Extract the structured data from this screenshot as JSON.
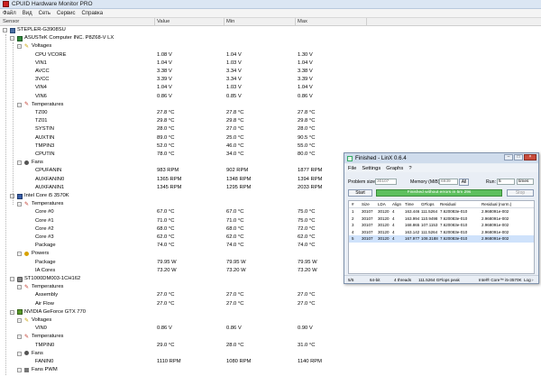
{
  "window": {
    "title": "CPUID Hardware Monitor PRO"
  },
  "menu": [
    "Файл",
    "Вид",
    "Сеть",
    "Сервис",
    "Справка"
  ],
  "columns": {
    "sensor": "Sensor",
    "value": "Value",
    "min": "Min",
    "max": "Max"
  },
  "tree": [
    {
      "indent": 0,
      "icon": "pc",
      "expander": true,
      "label": "STEPLER-G3908SU",
      "value": "",
      "min": "",
      "max": ""
    },
    {
      "indent": 1,
      "icon": "mb",
      "expander": true,
      "label": "ASUSTeK Computer INC. P8Z68-V LX",
      "value": "",
      "min": "",
      "max": ""
    },
    {
      "indent": 2,
      "icon": "volt",
      "expander": true,
      "label": "Voltages",
      "value": "",
      "min": "",
      "max": ""
    },
    {
      "indent": 3,
      "icon": "",
      "expander": false,
      "label": "CPU VCORE",
      "value": "1.08 V",
      "min": "1.04 V",
      "max": "1.30 V"
    },
    {
      "indent": 3,
      "icon": "",
      "expander": false,
      "label": "VIN1",
      "value": "1.04 V",
      "min": "1.03 V",
      "max": "1.04 V"
    },
    {
      "indent": 3,
      "icon": "",
      "expander": false,
      "label": "AVCC",
      "value": "3.38 V",
      "min": "3.34 V",
      "max": "3.38 V"
    },
    {
      "indent": 3,
      "icon": "",
      "expander": false,
      "label": "3VCC",
      "value": "3.39 V",
      "min": "3.34 V",
      "max": "3.39 V"
    },
    {
      "indent": 3,
      "icon": "",
      "expander": false,
      "label": "VIN4",
      "value": "1.04 V",
      "min": "1.03 V",
      "max": "1.04 V"
    },
    {
      "indent": 3,
      "icon": "",
      "expander": false,
      "label": "VIN6",
      "value": "0.86 V",
      "min": "0.85 V",
      "max": "0.86 V"
    },
    {
      "indent": 2,
      "icon": "temp",
      "expander": true,
      "label": "Temperatures",
      "value": "",
      "min": "",
      "max": ""
    },
    {
      "indent": 3,
      "icon": "",
      "expander": false,
      "label": "TZ00",
      "value": "27.8 °C",
      "min": "27.8 °C",
      "max": "27.8 °C"
    },
    {
      "indent": 3,
      "icon": "",
      "expander": false,
      "label": "TZ01",
      "value": "29.8 °C",
      "min": "29.8 °C",
      "max": "29.8 °C"
    },
    {
      "indent": 3,
      "icon": "",
      "expander": false,
      "label": "SYSTIN",
      "value": "28.0 °C",
      "min": "27.0 °C",
      "max": "28.0 °C"
    },
    {
      "indent": 3,
      "icon": "",
      "expander": false,
      "label": "AUXTIN",
      "value": "89.0 °C",
      "min": "25.0 °C",
      "max": "90.5 °C"
    },
    {
      "indent": 3,
      "icon": "",
      "expander": false,
      "label": "TMPIN3",
      "value": "52.0 °C",
      "min": "46.0 °C",
      "max": "55.0 °C"
    },
    {
      "indent": 3,
      "icon": "",
      "expander": false,
      "label": "CPUTIN",
      "value": "78.0 °C",
      "min": "34.0 °C",
      "max": "80.0 °C"
    },
    {
      "indent": 2,
      "icon": "fan",
      "expander": true,
      "label": "Fans",
      "value": "",
      "min": "",
      "max": ""
    },
    {
      "indent": 3,
      "icon": "",
      "expander": false,
      "label": "CPUFANIN",
      "value": "983 RPM",
      "min": "902 RPM",
      "max": "1877 RPM"
    },
    {
      "indent": 3,
      "icon": "",
      "expander": false,
      "label": "AUXFANIN0",
      "value": "1365 RPM",
      "min": "1348 RPM",
      "max": "1394 RPM"
    },
    {
      "indent": 3,
      "icon": "",
      "expander": false,
      "label": "AUXFANIN1",
      "value": "1345 RPM",
      "min": "1295 RPM",
      "max": "2033 RPM"
    },
    {
      "indent": 1,
      "icon": "cpu",
      "expander": true,
      "label": "Intel Core i5 3570K",
      "value": "",
      "min": "",
      "max": ""
    },
    {
      "indent": 2,
      "icon": "temp",
      "expander": true,
      "label": "Temperatures",
      "value": "",
      "min": "",
      "max": ""
    },
    {
      "indent": 3,
      "icon": "",
      "expander": false,
      "label": "Core #0",
      "value": "67.0 °C",
      "min": "67.0 °C",
      "max": "75.0 °C"
    },
    {
      "indent": 3,
      "icon": "",
      "expander": false,
      "label": "Core #1",
      "value": "71.0 °C",
      "min": "71.0 °C",
      "max": "75.0 °C"
    },
    {
      "indent": 3,
      "icon": "",
      "expander": false,
      "label": "Core #2",
      "value": "68.0 °C",
      "min": "68.0 °C",
      "max": "72.0 °C"
    },
    {
      "indent": 3,
      "icon": "",
      "expander": false,
      "label": "Core #3",
      "value": "62.0 °C",
      "min": "62.0 °C",
      "max": "62.0 °C"
    },
    {
      "indent": 3,
      "icon": "",
      "expander": false,
      "label": "Package",
      "value": "74.0 °C",
      "min": "74.0 °C",
      "max": "74.0 °C"
    },
    {
      "indent": 2,
      "icon": "pow",
      "expander": true,
      "label": "Powers",
      "value": "",
      "min": "",
      "max": ""
    },
    {
      "indent": 3,
      "icon": "",
      "expander": false,
      "label": "Package",
      "value": "79.95 W",
      "min": "79.95 W",
      "max": "79.95 W"
    },
    {
      "indent": 3,
      "icon": "",
      "expander": false,
      "label": "IA Cores",
      "value": "73.20 W",
      "min": "73.20 W",
      "max": "73.20 W"
    },
    {
      "indent": 1,
      "icon": "hdd",
      "expander": true,
      "label": "ST1000DM003-1CH162",
      "value": "",
      "min": "",
      "max": ""
    },
    {
      "indent": 2,
      "icon": "temp",
      "expander": true,
      "label": "Temperatures",
      "value": "",
      "min": "",
      "max": ""
    },
    {
      "indent": 3,
      "icon": "",
      "expander": false,
      "label": "Assembly",
      "value": "27.0 °C",
      "min": "27.0 °C",
      "max": "27.0 °C"
    },
    {
      "indent": 3,
      "icon": "",
      "expander": false,
      "label": "Air Flow",
      "value": "27.0 °C",
      "min": "27.0 °C",
      "max": "27.0 °C"
    },
    {
      "indent": 1,
      "icon": "gpu",
      "expander": true,
      "label": "NVIDIA GeForce GTX 770",
      "value": "",
      "min": "",
      "max": ""
    },
    {
      "indent": 2,
      "icon": "volt",
      "expander": true,
      "label": "Voltages",
      "value": "",
      "min": "",
      "max": ""
    },
    {
      "indent": 3,
      "icon": "",
      "expander": false,
      "label": "VIN0",
      "value": "0.86 V",
      "min": "0.86 V",
      "max": "0.90 V"
    },
    {
      "indent": 2,
      "icon": "temp",
      "expander": true,
      "label": "Temperatures",
      "value": "",
      "min": "",
      "max": ""
    },
    {
      "indent": 3,
      "icon": "",
      "expander": false,
      "label": "TMPIN0",
      "value": "29.0 °C",
      "min": "28.0 °C",
      "max": "31.0 °C"
    },
    {
      "indent": 2,
      "icon": "fan",
      "expander": true,
      "label": "Fans",
      "value": "",
      "min": "",
      "max": ""
    },
    {
      "indent": 3,
      "icon": "",
      "expander": false,
      "label": "FANIN0",
      "value": "1110 RPM",
      "min": "1080 RPM",
      "max": "1140 RPM"
    },
    {
      "indent": 2,
      "icon": "fanpwm",
      "expander": true,
      "label": "Fans PWM",
      "value": "",
      "min": "",
      "max": ""
    }
  ],
  "linx": {
    "title": "Finished - LinX 0.6.4",
    "menu": [
      "File",
      "Settings",
      "Graphs",
      "?"
    ],
    "problem_size_label": "Problem size:",
    "problem_size_value": "30107",
    "memory_label": "Memory (MiB):",
    "memory_value": "6939",
    "all_label": "All",
    "run_label": "Run:",
    "run_value": "5",
    "run_unit": "times",
    "start_label": "Start",
    "stop_label": "Stop",
    "status_text": "Finished without errors in 5m 29s",
    "table_headers": [
      "#",
      "Size",
      "LDA",
      "Align",
      "Time",
      "GFlops",
      "Residual",
      "Residual (norm.)"
    ],
    "table_rows": [
      [
        "1",
        "30107",
        "30120",
        "4",
        "163.446",
        "111.5264",
        "7.620083e-010",
        "2.968091e-002"
      ],
      [
        "2",
        "30107",
        "30120",
        "4",
        "163.994",
        "110.9498",
        "7.620083e-010",
        "2.968091e-002"
      ],
      [
        "3",
        "30107",
        "30120",
        "4",
        "168.865",
        "107.1153",
        "7.620083e-010",
        "2.968091e-002"
      ],
      [
        "4",
        "30107",
        "30120",
        "4",
        "163.142",
        "111.5264",
        "7.620083e-010",
        "2.968091e-002"
      ],
      [
        "5",
        "30107",
        "30120",
        "4",
        "167.977",
        "108.3188",
        "7.620083e-010",
        "2.968091e-002"
      ]
    ],
    "selected_row": 4,
    "statusbar": {
      "progress": "5/5",
      "bits": "64-bit",
      "threads": "4 threads",
      "peak": "111.5264 GFlops peak",
      "cpu": "Intel® Core™ i5-3570K",
      "log": "Log ›"
    }
  }
}
